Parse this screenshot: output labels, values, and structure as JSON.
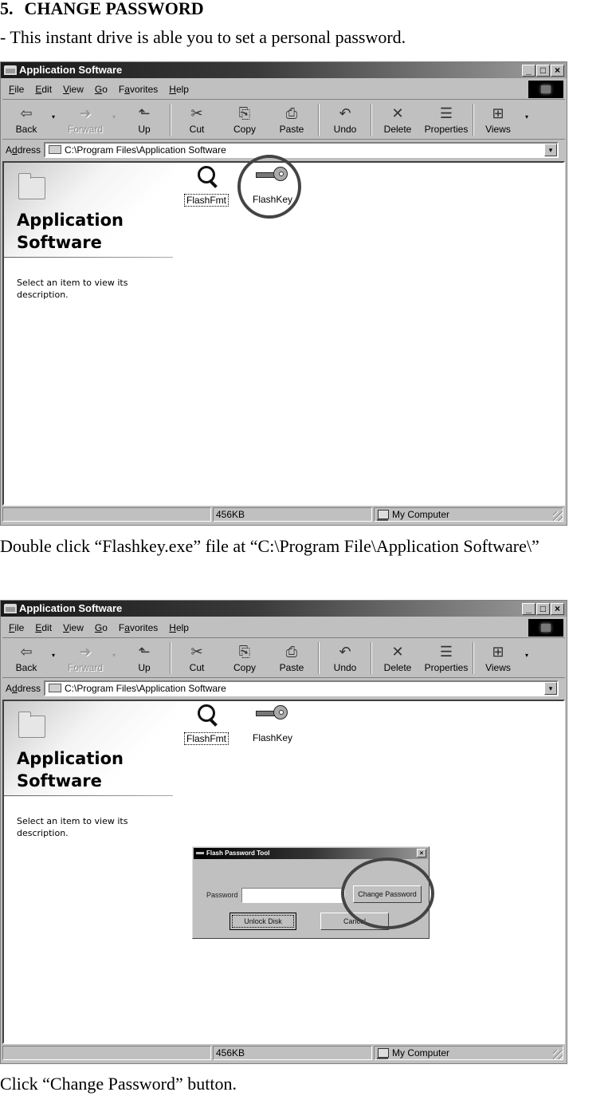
{
  "document": {
    "section_number": "5.",
    "section_title": "CHANGE PASSWORD",
    "intro": "- This instant drive is able you to set a personal password.",
    "caption_1": "Double click “Flashkey.exe” file at “C:\\Program File\\Application Software\\”",
    "caption_2": "Click “Change Password” button."
  },
  "window": {
    "title": "Application Software",
    "controls": {
      "minimize": "_",
      "maximize": "□",
      "close": "×"
    },
    "menu": [
      {
        "key": "F",
        "rest": "ile"
      },
      {
        "key": "E",
        "rest": "dit"
      },
      {
        "key": "V",
        "rest": "iew"
      },
      {
        "key": "G",
        "rest": "o"
      },
      {
        "pre": "F",
        "key": "a",
        "rest": "vorites"
      },
      {
        "key": "H",
        "rest": "elp"
      }
    ],
    "toolbar": {
      "back": "Back",
      "forward": "Forward",
      "up": "Up",
      "cut": "Cut",
      "copy": "Copy",
      "paste": "Paste",
      "undo": "Undo",
      "delete": "Delete",
      "properties": "Properties",
      "views": "Views"
    },
    "icons": {
      "back": "⇦",
      "forward": "➜",
      "up": "⬑",
      "cut": "✂",
      "copy": "⎘",
      "paste": "⎙",
      "undo": "↶",
      "delete": "✕",
      "properties": "☰",
      "views": "⊞",
      "dropdown": "▾"
    },
    "address": {
      "label_pre": "A",
      "label_key": "d",
      "label_rest": "dress",
      "value": "C:\\Program Files\\Application Software"
    },
    "sidebar": {
      "title_line1": "Application",
      "title_line2": "Software",
      "description": "Select an item to view its description."
    },
    "files": [
      {
        "name": "FlashFmt",
        "icon": "magnifier-icon"
      },
      {
        "name": "FlashKey",
        "icon": "key-icon"
      }
    ],
    "status": {
      "size": "456KB",
      "zone": "My Computer"
    }
  },
  "dialog": {
    "title": "Flash Password Tool",
    "close": "×",
    "password_label": "Password",
    "password_value": "",
    "change_button": "Change Password",
    "unlock_button": "Unlock Disk",
    "cancel_button": "Cancel"
  }
}
